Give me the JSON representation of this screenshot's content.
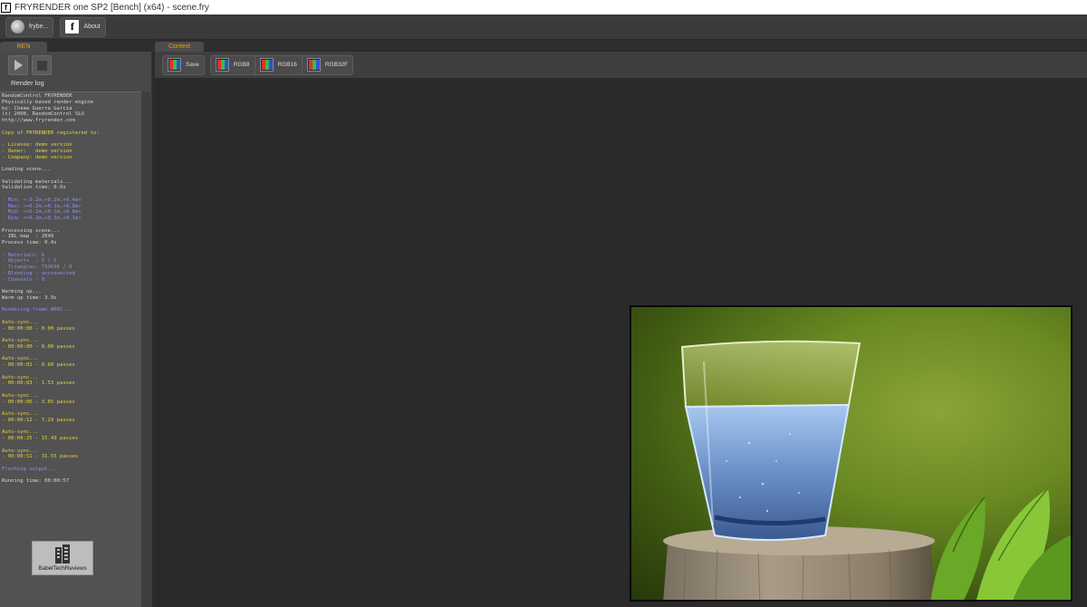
{
  "window": {
    "title": "FRYRENDER one SP2 [Bench] (x64) - scene.fry"
  },
  "toolbar": {
    "fry_button": "frybe...",
    "about_button": "About"
  },
  "left_panel": {
    "tab": "REN",
    "log_label": "Render log",
    "log_lines": [
      {
        "t": "RandomControl FRYRENDER",
        "c": ""
      },
      {
        "t": "Physically-based render engine",
        "c": ""
      },
      {
        "t": "by: Chema Guerra Garcia",
        "c": ""
      },
      {
        "t": "(c) 2008, RandomControl SLU",
        "c": ""
      },
      {
        "t": "http://www.fryrender.com",
        "c": ""
      },
      {
        "t": "",
        "c": ""
      },
      {
        "t": "Copy of FRYRENDER registered to:",
        "c": "y"
      },
      {
        "t": "",
        "c": ""
      },
      {
        "t": "- License: demo version",
        "c": "y"
      },
      {
        "t": "- Owner:   demo version",
        "c": "y"
      },
      {
        "t": "- Company: demo version",
        "c": "y"
      },
      {
        "t": "",
        "c": ""
      },
      {
        "t": "Loading scene...",
        "c": ""
      },
      {
        "t": "",
        "c": ""
      },
      {
        "t": "Validating materials...",
        "c": ""
      },
      {
        "t": "Validation time: 0.0s",
        "c": ""
      },
      {
        "t": "",
        "c": ""
      },
      {
        "t": "- Min: <-0.2m,+0.2m,+0.4m>",
        "c": "b"
      },
      {
        "t": "- Max: <+0.2m,+0.1m,+0.8m>",
        "c": "b"
      },
      {
        "t": "- Mid: <+0.1m,+0.1m,+0.8m>",
        "c": "b"
      },
      {
        "t": "- Dim: <+0.1m,+0.3m,+0.1m>",
        "c": "b"
      },
      {
        "t": "",
        "c": ""
      },
      {
        "t": "Processing scene...",
        "c": ""
      },
      {
        "t": "- IBL map  : 2048",
        "c": ""
      },
      {
        "t": "Process time: 0.4s",
        "c": ""
      },
      {
        "t": "",
        "c": ""
      },
      {
        "t": "- Materials: 6",
        "c": "b"
      },
      {
        "t": "- Objects  : 5 / 5",
        "c": "b"
      },
      {
        "t": "- Triangles: 733696 / 0",
        "c": "b"
      },
      {
        "t": "- Blending : unconnected",
        "c": "b"
      },
      {
        "t": "- Channels : 0",
        "c": "b"
      },
      {
        "t": "",
        "c": ""
      },
      {
        "t": "Warming up...",
        "c": ""
      },
      {
        "t": "Warm up time: 3.9s",
        "c": ""
      },
      {
        "t": "",
        "c": ""
      },
      {
        "t": "Rendering frame #001...",
        "c": "b"
      },
      {
        "t": "",
        "c": ""
      },
      {
        "t": "Auto-sync...",
        "c": "y"
      },
      {
        "t": "- 00:00:00 - 0.00 passes",
        "c": "y"
      },
      {
        "t": "",
        "c": ""
      },
      {
        "t": "Auto-sync...",
        "c": "y"
      },
      {
        "t": "- 00:00:00 - 0.00 passes",
        "c": "y"
      },
      {
        "t": "",
        "c": ""
      },
      {
        "t": "Auto-sync...",
        "c": "y"
      },
      {
        "t": "- 00:00:01 - 0.60 passes",
        "c": "y"
      },
      {
        "t": "",
        "c": ""
      },
      {
        "t": "Auto-sync...",
        "c": "y"
      },
      {
        "t": "- 00:00:03 - 1.53 passes",
        "c": "y"
      },
      {
        "t": "",
        "c": ""
      },
      {
        "t": "Auto-sync...",
        "c": "y"
      },
      {
        "t": "- 00:00:06 - 3.65 passes",
        "c": "y"
      },
      {
        "t": "",
        "c": ""
      },
      {
        "t": "Auto-sync...",
        "c": "y"
      },
      {
        "t": "- 00:00:12 - 7.29 passes",
        "c": "y"
      },
      {
        "t": "",
        "c": ""
      },
      {
        "t": "Auto-sync...",
        "c": "y"
      },
      {
        "t": "- 00:00:25 - 15.49 passes",
        "c": "y"
      },
      {
        "t": "",
        "c": ""
      },
      {
        "t": "Auto-sync...",
        "c": "y"
      },
      {
        "t": "- 00:00:51 - 31.55 passes",
        "c": "y"
      },
      {
        "t": "",
        "c": ""
      },
      {
        "t": "Flushing output...",
        "c": "b"
      },
      {
        "t": "",
        "c": ""
      },
      {
        "t": "Running time: 00:00:57",
        "c": ""
      }
    ],
    "watermark": "BabelTechReviews"
  },
  "context": {
    "tab": "Context",
    "save_button": "Save",
    "rgb8_button": "RGB8",
    "rgb16_button": "RGB16",
    "rgb32f_button": "RGB32F"
  },
  "colors": {
    "accent_tab_text": "#e8a020",
    "log_yellow": "#e6d23a",
    "log_blue": "#8f8ff0"
  }
}
